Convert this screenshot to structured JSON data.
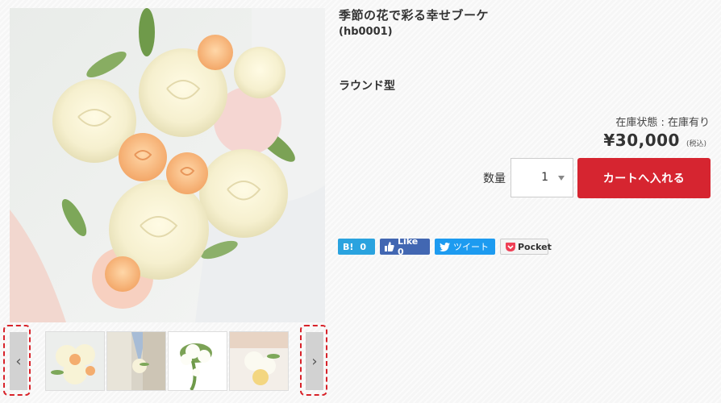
{
  "product": {
    "title": "季節の花で彩る幸せブーケ",
    "code": "(hb0001)",
    "shape": "ラウンド型",
    "stock": "在庫状態 : 在庫有り",
    "price": "¥30,000",
    "tax_note": "(税込)"
  },
  "purchase": {
    "qty_label": "数量",
    "qty_value": "1",
    "cart_button": "カートへ入れる"
  },
  "share": {
    "hatena_label": "B!",
    "hatena_count": "0",
    "facebook_label": "Like 0",
    "twitter_label": "ツイート",
    "pocket_label": "Pocket"
  },
  "gallery": {
    "prev_label": "‹",
    "next_label": "›",
    "thumbnails": [
      "bouquet-round",
      "bouquet-groom",
      "bouquet-cascade",
      "bouquet-bridal"
    ]
  },
  "colors": {
    "cart_button": "#d62530",
    "highlight_dash": "#d8232a",
    "hatena": "#2aa3df",
    "facebook": "#4267b2",
    "twitter": "#1d9bf0"
  }
}
